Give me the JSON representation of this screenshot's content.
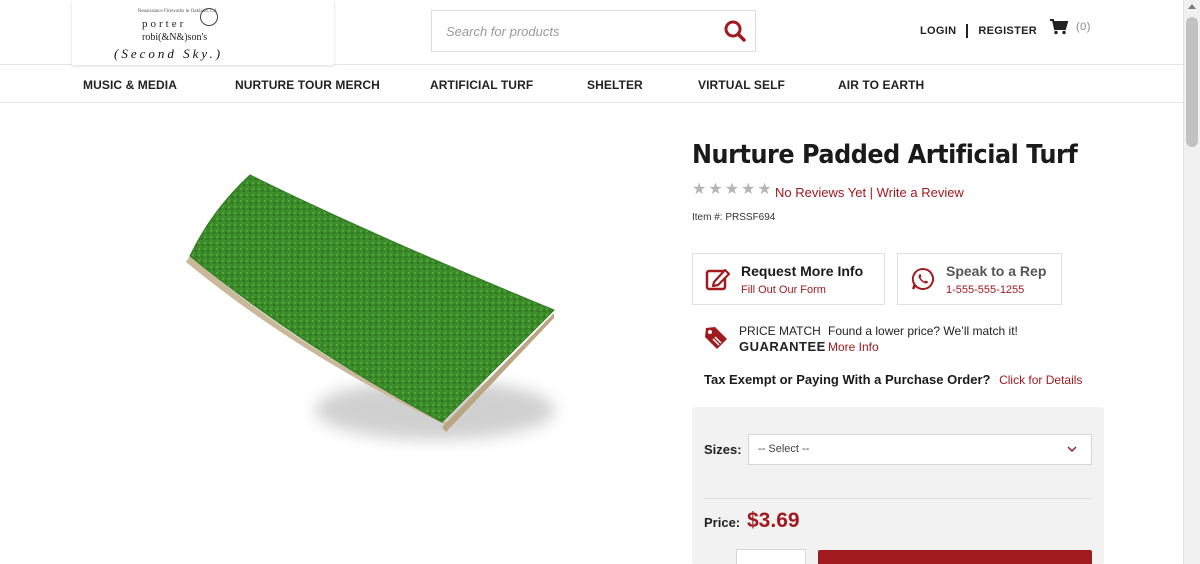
{
  "logo": {
    "tiny_line": "Renaissance Fireworks in Oakland, CA",
    "line1": "porter",
    "line2": "robi(&N&)son's",
    "line3": "(Second Sky.)"
  },
  "search": {
    "placeholder": "Search for products"
  },
  "header": {
    "login": "LOGIN",
    "register": "REGISTER",
    "cart_count": "(0)"
  },
  "nav": {
    "items": [
      {
        "label": "MUSIC & MEDIA"
      },
      {
        "label": "NURTURE TOUR MERCH"
      },
      {
        "label": "ARTIFICIAL TURF"
      },
      {
        "label": "SHELTER"
      },
      {
        "label": "VIRTUAL SELF"
      },
      {
        "label": "AIR TO EARTH"
      }
    ]
  },
  "product": {
    "title": "Nurture Padded Artificial Turf",
    "rating": 0,
    "rating_max": 5,
    "reviews_text": "No Reviews Yet | Write a Review",
    "item_number": "Item #: PRSSF694",
    "request_info": {
      "title": "Request More Info",
      "sub": "Fill Out Our Form"
    },
    "speak_rep": {
      "title": "Speak to a Rep",
      "sub": "1-555-555-1255"
    },
    "price_match": {
      "line1": "PRICE MATCH",
      "line2": "GUARANTEE",
      "text": "Found a lower price? We’ll match it!",
      "link": "More Info"
    },
    "tax": {
      "text": "Tax Exempt or Paying With a Purchase Order?",
      "link": "Click for Details"
    },
    "sizes_label": "Sizes:",
    "sizes_selected": "-- Select --",
    "price_label": "Price:",
    "price": "$3.69"
  },
  "colors": {
    "accent": "#a01a20",
    "turf_green": "#3a8a2a",
    "panel_bg": "#f2f2f2"
  },
  "icons": {
    "search": "search-icon",
    "cart": "cart-icon",
    "form": "edit-form-icon",
    "phone": "whatsapp-phone-icon",
    "tag": "price-tag-icon",
    "chevron": "chevron-down-icon"
  }
}
